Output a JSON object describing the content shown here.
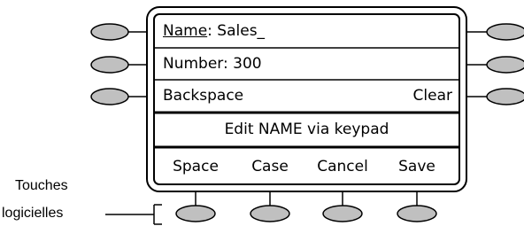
{
  "display": {
    "name_label": "Name",
    "name_separator": ":",
    "name_value": "Sales_",
    "number_line": "Number: 300",
    "backspace_label": "Backspace",
    "clear_label": "Clear",
    "prompt": "Edit NAME via keypad",
    "softkeys": [
      "Space",
      "Case",
      "Cancel",
      "Save"
    ]
  },
  "annotation": {
    "line1": "Touches",
    "line2": "logicielles"
  },
  "colors": {
    "button_fill": "#c0c0c0",
    "outline": "#000000",
    "background": "#ffffff"
  }
}
